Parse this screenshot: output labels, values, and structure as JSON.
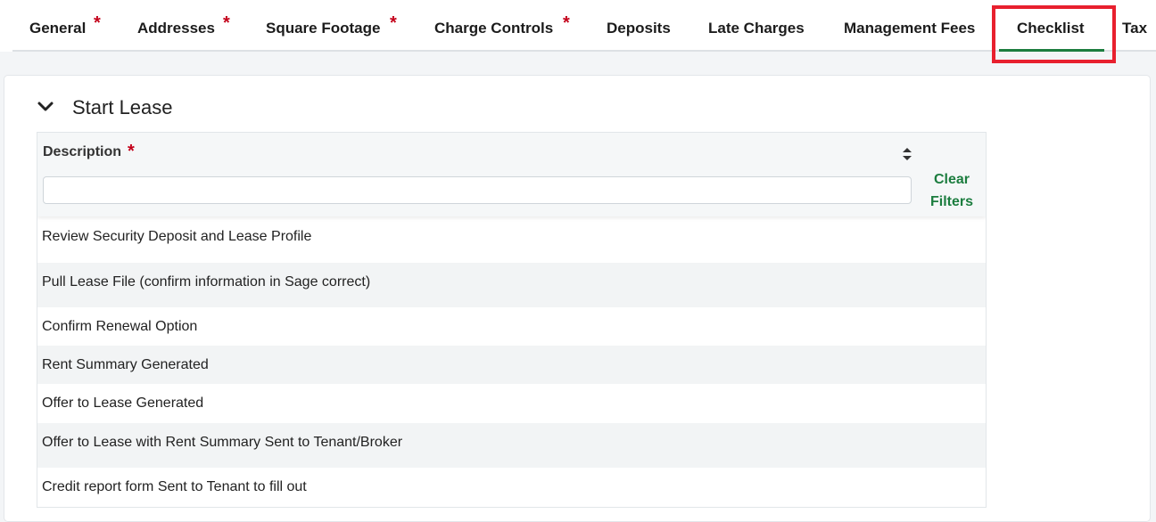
{
  "tabs": [
    {
      "label": "General",
      "required": true
    },
    {
      "label": "Addresses",
      "required": true
    },
    {
      "label": "Square Footage",
      "required": true
    },
    {
      "label": "Charge Controls",
      "required": true
    },
    {
      "label": "Deposits",
      "required": false
    },
    {
      "label": "Late Charges",
      "required": false
    },
    {
      "label": "Management Fees",
      "required": false
    },
    {
      "label": "Checklist",
      "required": false,
      "active": true
    },
    {
      "label": "Tax",
      "required": false
    }
  ],
  "required_marker": "*",
  "colors": {
    "accent": "#1c7d3f",
    "required": "#c4001a",
    "highlight": "#e8202e"
  },
  "section": {
    "title": "Start Lease",
    "expanded": true,
    "icon": "chevron-down-icon"
  },
  "grid": {
    "column_header": "Description",
    "sort_icon": "sort-icon",
    "filter_value": "",
    "clear_filters_line1": "Clear",
    "clear_filters_line2": "Filters",
    "rows": [
      "Review Security Deposit and Lease Profile",
      "Pull Lease File (confirm information in Sage correct)",
      "Confirm Renewal Option",
      "Rent Summary Generated",
      "Offer to Lease Generated",
      "Offer to Lease with Rent Summary Sent to Tenant/Broker",
      "Credit report form Sent to Tenant to fill out"
    ]
  }
}
